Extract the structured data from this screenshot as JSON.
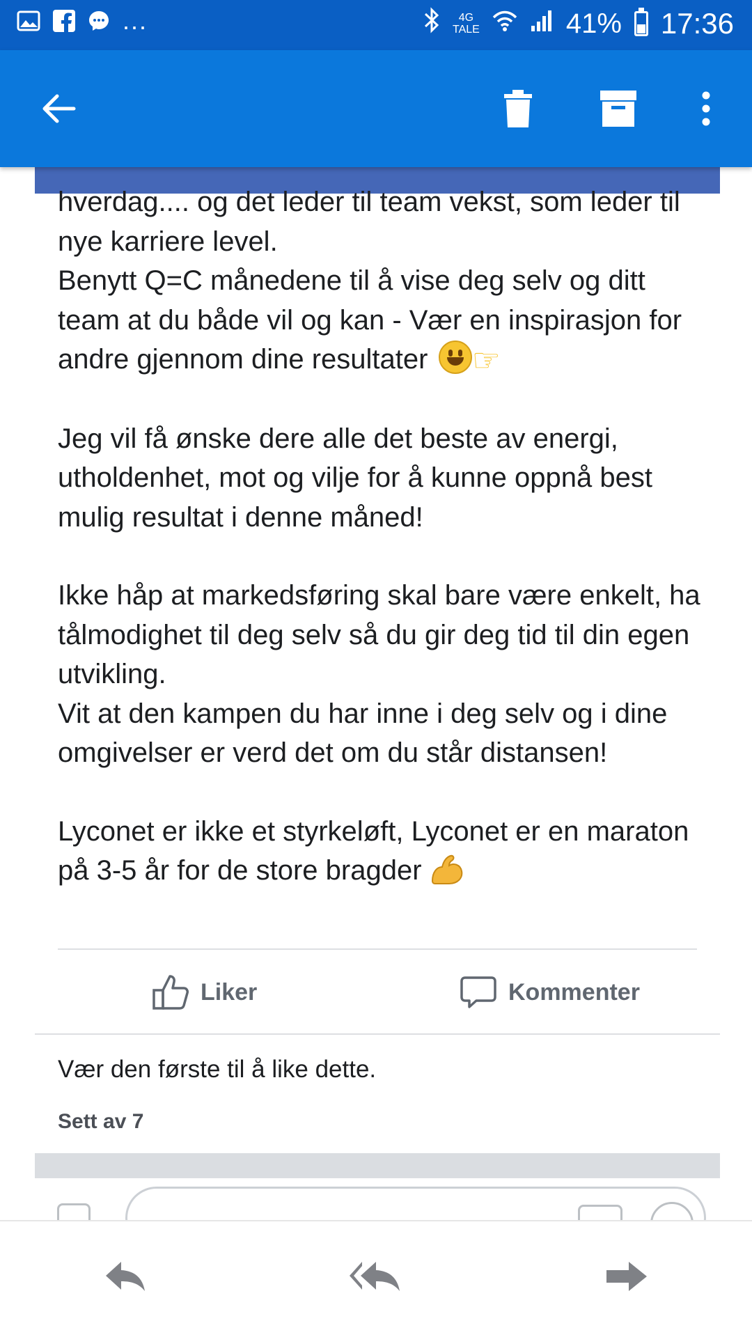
{
  "status_bar": {
    "network_top": "4G",
    "network_bottom": "TALE",
    "battery": "41%",
    "time": "17:36",
    "notification_overflow": "..."
  },
  "post": {
    "paragraphs": [
      "hverdag.... og det leder til team vekst, som leder til nye karriere level.",
      "Benytt Q=C månedene til å vise deg selv og ditt team at du både vil og kan - Vær en inspirasjon for andre gjennom dine resultater",
      "",
      "Jeg vil få ønske dere alle det beste av energi, utholdenhet, mot og vilje for å kunne oppnå best mulig resultat i denne måned!",
      "",
      "Ikke håp at markedsføring skal bare være enkelt, ha tålmodighet til deg selv så du gir deg tid til din egen utvikling.",
      "Vit at den kampen du har inne i deg selv og i dine omgivelser er verd det om du står distansen!",
      "",
      "Lyconet er ikke et styrkeløft, Lyconet er en maraton på 3-5 år for de store bragder"
    ]
  },
  "actions": {
    "like_label": "Liker",
    "comment_label": "Kommenter"
  },
  "reactions": {
    "like_prompt": "Vær den første til å like dette.",
    "seen_by": "Sett av 7"
  },
  "colors": {
    "status_bar": "#0a5fc4",
    "app_bar": "#0b78dc",
    "header_band": "#4567b7",
    "text": "#1c1e21",
    "muted": "#606770"
  },
  "icons": [
    "back-arrow-icon",
    "delete-icon",
    "archive-icon",
    "more-vert-icon",
    "like-icon",
    "comment-icon",
    "reply-icon",
    "reply-all-icon",
    "forward-icon"
  ]
}
